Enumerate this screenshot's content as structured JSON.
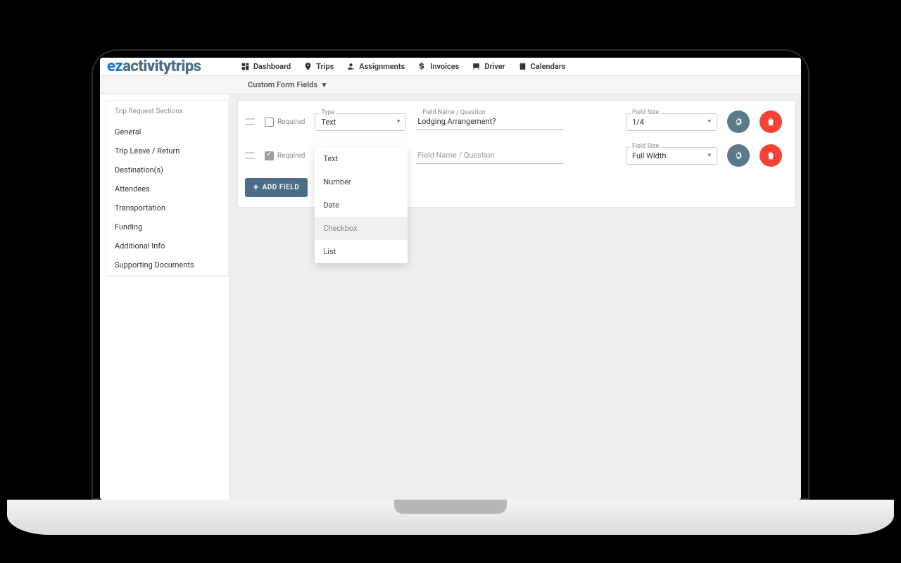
{
  "logo": {
    "part1": "ez",
    "part2": "activitytrips"
  },
  "nav": {
    "dashboard": "Dashboard",
    "trips": "Trips",
    "assignments": "Assignments",
    "invoices": "Invoices",
    "driver": "Driver",
    "calendars": "Calendars"
  },
  "subnav": {
    "label": "Custom Form Fields"
  },
  "sidebar": {
    "title": "Trip Request Sections",
    "items": [
      "General",
      "Trip Leave / Return",
      "Destination(s)",
      "Attendees",
      "Transportation",
      "Funding",
      "Additional Info",
      "Supporting Documents"
    ]
  },
  "labels": {
    "required": "Required",
    "type": "Type",
    "fieldname": "Field Name / Question",
    "fieldsize": "Field Size"
  },
  "rows": [
    {
      "required": false,
      "type": "Text",
      "name": "Lodging Arrangement?",
      "size": "1/4"
    },
    {
      "required": true,
      "type": "",
      "name": "",
      "size": "Full Width"
    }
  ],
  "fieldname_placeholder": "Field Name / Question",
  "type_options": [
    "Text",
    "Number",
    "Date",
    "Checkbox",
    "List"
  ],
  "type_highlighted": "Checkbox",
  "add_field_label": "ADD FIELD"
}
